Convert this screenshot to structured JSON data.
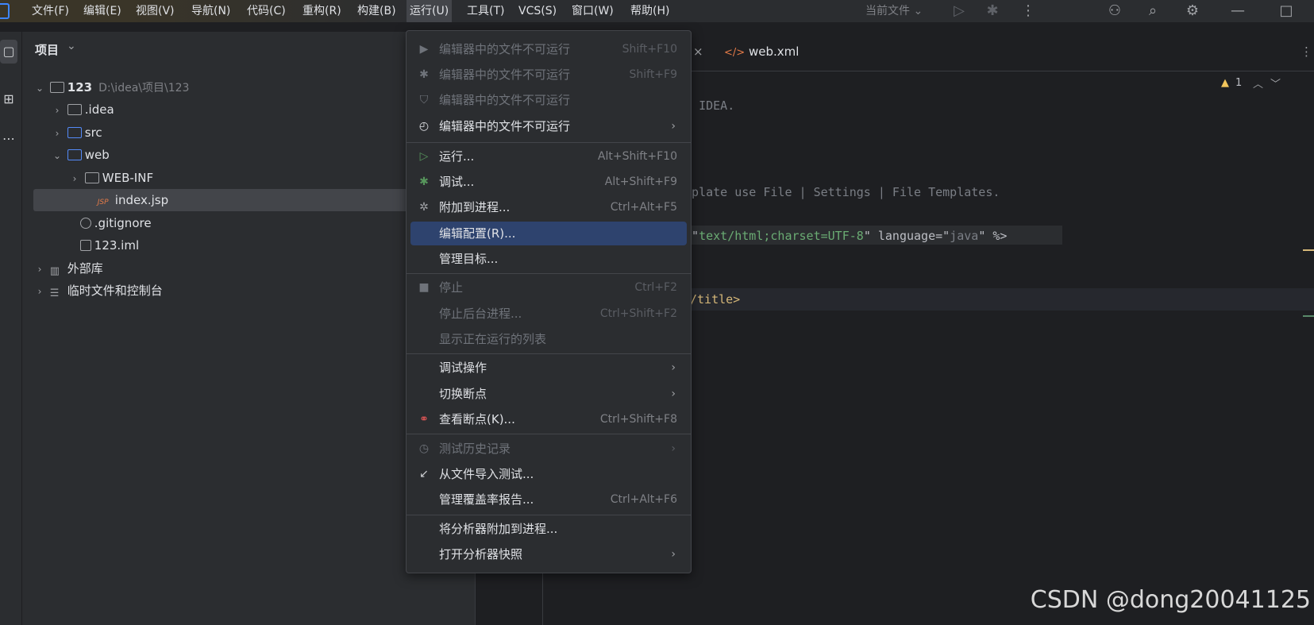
{
  "menubar": {
    "items": [
      "文件(F)",
      "编辑(E)",
      "视图(V)",
      "导航(N)",
      "代码(C)",
      "重构(R)",
      "构建(B)",
      "运行(U)",
      "工具(T)",
      "VCS(S)",
      "窗口(W)",
      "帮助(H)"
    ],
    "current_file": "当前文件"
  },
  "project_panel": {
    "title": "项目",
    "tree": [
      {
        "label": "123",
        "hint": "D:\\idea\\项目\\123",
        "icon": "module-folder-icon"
      },
      {
        "label": ".idea",
        "icon": "folder-icon"
      },
      {
        "label": "src",
        "icon": "source-folder-icon"
      },
      {
        "label": "web",
        "icon": "web-folder-icon"
      },
      {
        "label": "WEB-INF",
        "icon": "folder-icon"
      },
      {
        "label": "index.jsp",
        "icon": "jsp-file-icon",
        "jsp_badge": "JSP"
      },
      {
        "label": ".gitignore",
        "icon": "ignore-file-icon"
      },
      {
        "label": "123.iml",
        "icon": "iml-file-icon"
      },
      {
        "label": "外部库",
        "icon": "library-icon"
      },
      {
        "label": "临时文件和控制台",
        "icon": "scratch-icon"
      }
    ]
  },
  "editor": {
    "tabs": [
      "web.xml"
    ],
    "warning_count": "1",
    "lines": {
      "l1": "iJ IDEA.",
      "l2": "emplate use File | Settings | File Templates.",
      "l3_a": "e=\"",
      "l3_b": "text/html;charset=UTF-8",
      "l3_c": "\" language=\"",
      "l3_d": "java",
      "l3_e": "\" %>",
      "l4": "/title>"
    }
  },
  "run_menu": {
    "items": [
      {
        "label": "编辑器中的文件不可运行",
        "shortcut": "Shift+F10",
        "icon": "run-icon",
        "disabled": true
      },
      {
        "label": "编辑器中的文件不可运行",
        "shortcut": "Shift+F9",
        "icon": "debug-icon",
        "disabled": true
      },
      {
        "label": "编辑器中的文件不可运行",
        "shortcut": "",
        "icon": "coverage-icon",
        "disabled": true
      },
      {
        "label": "编辑器中的文件不可运行",
        "shortcut": "",
        "icon": "profile-icon",
        "disabled": false
      },
      {
        "label": "运行...",
        "shortcut": "Alt+Shift+F10",
        "icon": "run-icon",
        "disabled": false
      },
      {
        "label": "调试...",
        "shortcut": "Alt+Shift+F9",
        "icon": "debug-icon",
        "disabled": false
      },
      {
        "label": "附加到进程...",
        "shortcut": "Ctrl+Alt+F5",
        "icon": "attach-icon",
        "disabled": false
      },
      {
        "label": "编辑配置(R)...",
        "shortcut": "",
        "icon": "",
        "disabled": false
      },
      {
        "label": "管理目标...",
        "shortcut": "",
        "icon": "",
        "disabled": false
      },
      {
        "label": "停止",
        "shortcut": "Ctrl+F2",
        "icon": "stop-icon",
        "disabled": true
      },
      {
        "label": "停止后台进程...",
        "shortcut": "Ctrl+Shift+F2",
        "icon": "",
        "disabled": true
      },
      {
        "label": "显示正在运行的列表",
        "shortcut": "",
        "icon": "",
        "disabled": true
      },
      {
        "label": "调试操作",
        "shortcut": "",
        "icon": "",
        "disabled": false
      },
      {
        "label": "切换断点",
        "shortcut": "",
        "icon": "",
        "disabled": false
      },
      {
        "label": "查看断点(K)...",
        "shortcut": "Ctrl+Shift+F8",
        "icon": "breakpoints-icon",
        "disabled": false
      },
      {
        "label": "测试历史记录",
        "shortcut": "",
        "icon": "history-icon",
        "disabled": true
      },
      {
        "label": "从文件导入测试...",
        "shortcut": "",
        "icon": "import-icon",
        "disabled": false
      },
      {
        "label": "管理覆盖率报告...",
        "shortcut": "Ctrl+Alt+F6",
        "icon": "",
        "disabled": false
      },
      {
        "label": "将分析器附加到进程...",
        "shortcut": "",
        "icon": "",
        "disabled": false
      },
      {
        "label": "打开分析器快照",
        "shortcut": "",
        "icon": "",
        "disabled": false
      }
    ]
  },
  "watermark": "CSDN @dong20041125",
  "colors": {
    "accent": "#3574f0",
    "selection": "#2e436e",
    "string": "#6aab73",
    "tag": "#d5b778"
  }
}
